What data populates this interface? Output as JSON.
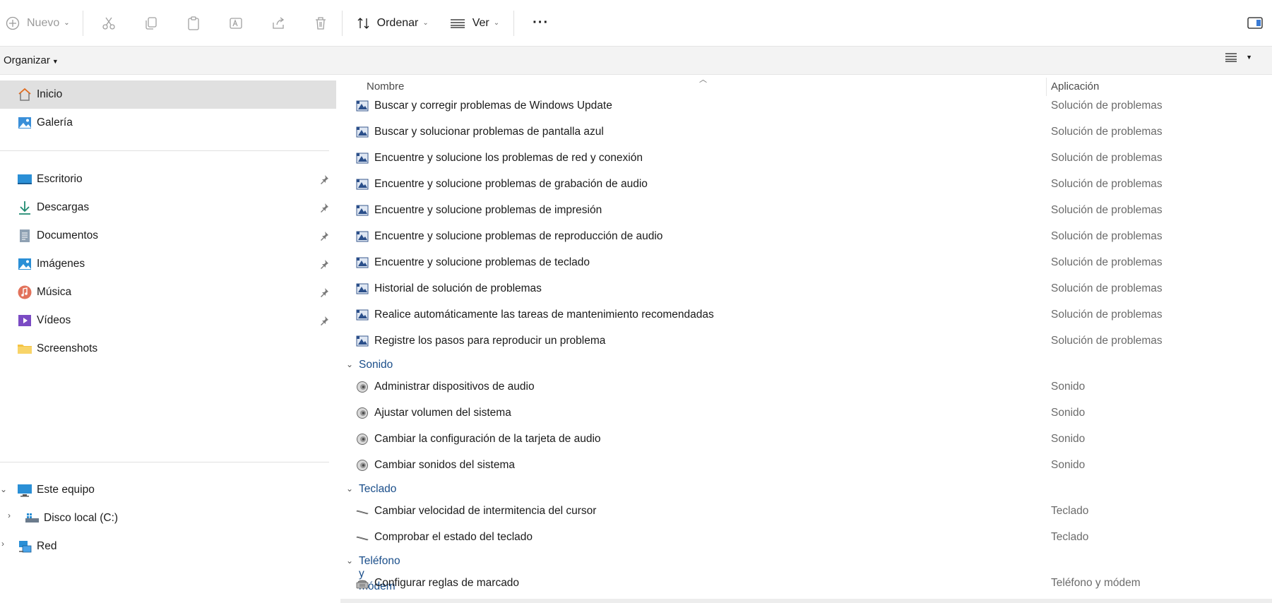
{
  "toolbar": {
    "new_label": "Nuevo",
    "sort_label": "Ordenar",
    "view_label": "Ver",
    "more_label": "···"
  },
  "orgbar": {
    "organize_label": "Organizar"
  },
  "sidebar": {
    "quick": [
      {
        "label": "Inicio",
        "icon": "home-icon"
      },
      {
        "label": "Galería",
        "icon": "gallery-icon"
      }
    ],
    "pinned": [
      {
        "label": "Escritorio",
        "icon": "desktop-icon"
      },
      {
        "label": "Descargas",
        "icon": "download-icon"
      },
      {
        "label": "Documentos",
        "icon": "document-icon"
      },
      {
        "label": "Imágenes",
        "icon": "pictures-icon"
      },
      {
        "label": "Música",
        "icon": "music-icon"
      },
      {
        "label": "Vídeos",
        "icon": "videos-icon"
      },
      {
        "label": "Screenshots",
        "icon": "folder-icon"
      }
    ],
    "tree": [
      {
        "label": "Este equipo",
        "icon": "computer-icon"
      },
      {
        "label": "Disco local (C:)",
        "icon": "drive-icon"
      },
      {
        "label": "Red",
        "icon": "network-icon"
      }
    ]
  },
  "columns": {
    "name": "Nombre",
    "app": "Aplicación"
  },
  "troubleshoot_rows": [
    {
      "name": "Buscar y corregir problemas de Windows Update",
      "app": "Solución de problemas"
    },
    {
      "name": "Buscar y solucionar problemas de pantalla azul",
      "app": "Solución de problemas"
    },
    {
      "name": "Encuentre y solucione los problemas de red y conexión",
      "app": "Solución de problemas"
    },
    {
      "name": "Encuentre y solucione problemas de grabación de audio",
      "app": "Solución de problemas"
    },
    {
      "name": "Encuentre y solucione problemas de impresión",
      "app": "Solución de problemas"
    },
    {
      "name": "Encuentre y solucione problemas de reproducción de audio",
      "app": "Solución de problemas"
    },
    {
      "name": "Encuentre y solucione problemas de teclado",
      "app": "Solución de problemas"
    },
    {
      "name": "Historial de solución de problemas",
      "app": "Solución de problemas"
    },
    {
      "name": "Realice automáticamente las tareas de mantenimiento recomendadas",
      "app": "Solución de problemas"
    },
    {
      "name": "Registre los pasos para reproducir un problema",
      "app": "Solución de problemas"
    }
  ],
  "groups": {
    "sound": {
      "label": "Sonido",
      "rows": [
        {
          "name": "Administrar dispositivos de audio",
          "app": "Sonido"
        },
        {
          "name": "Ajustar volumen del sistema",
          "app": "Sonido"
        },
        {
          "name": "Cambiar la configuración de la tarjeta de audio",
          "app": "Sonido"
        },
        {
          "name": "Cambiar sonidos del sistema",
          "app": "Sonido"
        }
      ]
    },
    "keyboard": {
      "label": "Teclado",
      "rows": [
        {
          "name": "Cambiar velocidad de intermitencia del cursor",
          "app": "Teclado"
        },
        {
          "name": "Comprobar el estado del teclado",
          "app": "Teclado"
        }
      ]
    },
    "phone": {
      "label": "Teléfono y módem",
      "rows": [
        {
          "name": "Configurar reglas de marcado",
          "app": "Teléfono y módem"
        }
      ]
    }
  }
}
